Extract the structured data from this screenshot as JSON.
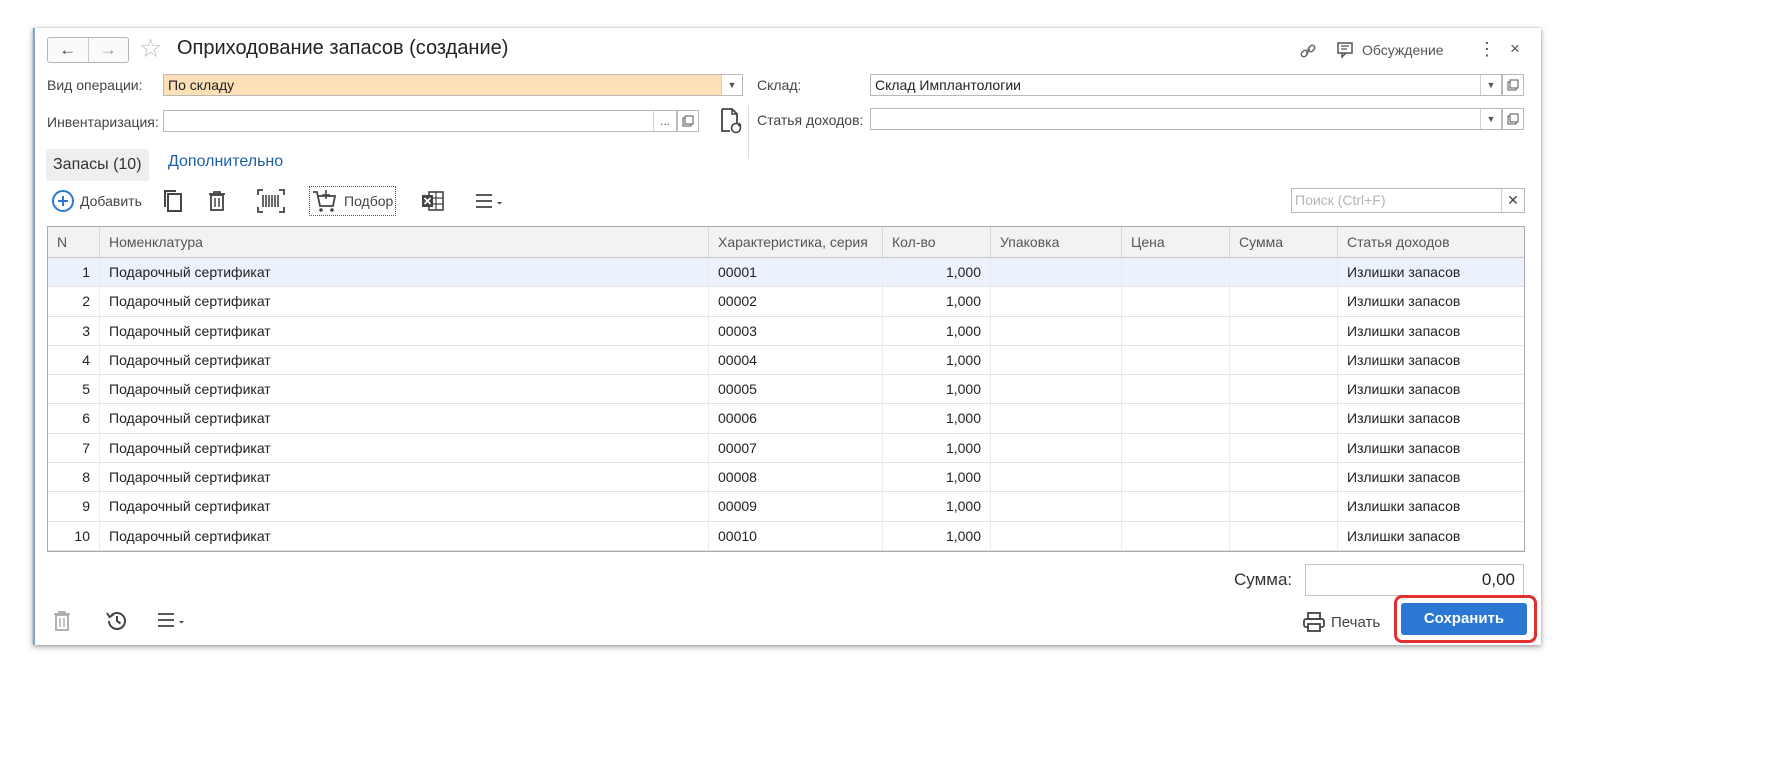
{
  "window": {
    "title": "Оприходование запасов (создание)",
    "header_links": {
      "discussion": "Обсуждение"
    }
  },
  "form": {
    "operation_type_label": "Вид операции:",
    "operation_type_value": "По складу",
    "inventory_label": "Инвентаризация:",
    "inventory_value": "",
    "inventory_dots": "...",
    "warehouse_label": "Склад:",
    "warehouse_value": "Склад Имплантологии",
    "income_item_label": "Статья доходов:",
    "income_item_value": ""
  },
  "tabs": [
    {
      "label": "Запасы (10)",
      "active": true
    },
    {
      "label": "Дополнительно",
      "active": false
    }
  ],
  "toolbar": {
    "add_label": "Добавить",
    "selection_label": "Подбор",
    "search_placeholder": "Поиск (Ctrl+F)"
  },
  "table": {
    "columns": [
      "N",
      "Номенклатура",
      "Характеристика, серия",
      "Кол-во",
      "Упаковка",
      "Цена",
      "Сумма",
      "Статья доходов"
    ],
    "rows": [
      [
        "1",
        "Подарочный сертификат",
        "00001",
        "1,000",
        "",
        "",
        "",
        "Излишки запасов"
      ],
      [
        "2",
        "Подарочный сертификат",
        "00002",
        "1,000",
        "",
        "",
        "",
        "Излишки запасов"
      ],
      [
        "3",
        "Подарочный сертификат",
        "00003",
        "1,000",
        "",
        "",
        "",
        "Излишки запасов"
      ],
      [
        "4",
        "Подарочный сертификат",
        "00004",
        "1,000",
        "",
        "",
        "",
        "Излишки запасов"
      ],
      [
        "5",
        "Подарочный сертификат",
        "00005",
        "1,000",
        "",
        "",
        "",
        "Излишки запасов"
      ],
      [
        "6",
        "Подарочный сертификат",
        "00006",
        "1,000",
        "",
        "",
        "",
        "Излишки запасов"
      ],
      [
        "7",
        "Подарочный сертификат",
        "00007",
        "1,000",
        "",
        "",
        "",
        "Излишки запасов"
      ],
      [
        "8",
        "Подарочный сертификат",
        "00008",
        "1,000",
        "",
        "",
        "",
        "Излишки запасов"
      ],
      [
        "9",
        "Подарочный сертификат",
        "00009",
        "1,000",
        "",
        "",
        "",
        "Излишки запасов"
      ],
      [
        "10",
        "Подарочный сертификат",
        "00010",
        "1,000",
        "",
        "",
        "",
        "Излишки запасов"
      ]
    ]
  },
  "footer": {
    "sum_label": "Сумма:",
    "sum_value": "0,00",
    "print_label": "Печать",
    "save_label": "Сохранить"
  },
  "colors": {
    "accent_blue": "#2a78d4",
    "highlight_field": "#fde0b8",
    "link_blue": "#1f5fa8",
    "save_outline": "#e03030"
  }
}
